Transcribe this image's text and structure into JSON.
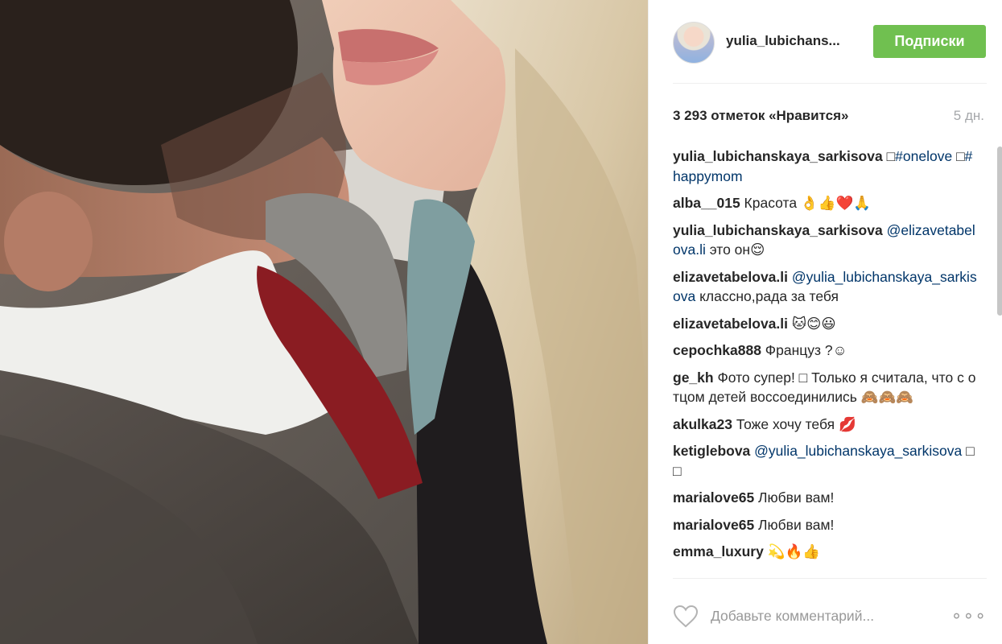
{
  "post": {
    "author": "yulia_lubichans...",
    "follow_label": "Подписки",
    "likes": "3 293 отметок «Нравится»",
    "time": "5 дн."
  },
  "comments": [
    {
      "author": "yulia_lubichanskaya_sarkisova",
      "parts": [
        {
          "t": "text",
          "v": " □"
        },
        {
          "t": "mention",
          "v": "#onelove"
        },
        {
          "t": "text",
          "v": " □"
        },
        {
          "t": "mention",
          "v": "#happymom"
        }
      ]
    },
    {
      "author": "alba__015",
      "parts": [
        {
          "t": "text",
          "v": " Красота 👌👍❤️🙏"
        }
      ]
    },
    {
      "author": "yulia_lubichanskaya_sarkisova",
      "parts": [
        {
          "t": "text",
          "v": " "
        },
        {
          "t": "mention",
          "v": "@elizavetabelova.li"
        },
        {
          "t": "text",
          "v": " это он😌"
        }
      ]
    },
    {
      "author": "elizavetabelova.li",
      "parts": [
        {
          "t": "text",
          "v": " "
        },
        {
          "t": "mention",
          "v": "@yulia_lubichanskaya_sarkisova"
        },
        {
          "t": "text",
          "v": " классно,рада за тебя"
        }
      ]
    },
    {
      "author": "elizavetabelova.li",
      "parts": [
        {
          "t": "text",
          "v": " 🐱😊😃"
        }
      ]
    },
    {
      "author": "cepochka888",
      "parts": [
        {
          "t": "text",
          "v": " Француз ?☺"
        }
      ]
    },
    {
      "author": "ge_kh",
      "parts": [
        {
          "t": "text",
          "v": " Фото супер! □ Только я считала, что с отцом детей воссоединились 🙈🙈🙈"
        }
      ]
    },
    {
      "author": "akulka23",
      "parts": [
        {
          "t": "text",
          "v": " Тоже хочу тебя 💋"
        }
      ]
    },
    {
      "author": "ketiglebova",
      "parts": [
        {
          "t": "text",
          "v": " "
        },
        {
          "t": "mention",
          "v": "@yulia_lubichanskaya_sarkisova"
        },
        {
          "t": "text",
          "v": " □□"
        }
      ]
    },
    {
      "author": "marialove65",
      "parts": [
        {
          "t": "text",
          "v": " Любви вам!"
        }
      ]
    },
    {
      "author": "marialove65",
      "parts": [
        {
          "t": "text",
          "v": " Любви вам!"
        }
      ]
    },
    {
      "author": "emma_luxury",
      "parts": [
        {
          "t": "text",
          "v": " 💫🔥👍"
        }
      ]
    }
  ],
  "footer": {
    "comment_placeholder": "Добавьте комментарий...",
    "more_label": "∘∘∘"
  },
  "icons": {
    "heart": "heart-icon",
    "more": "more-options-icon"
  },
  "colors": {
    "follow_button": "#70c050",
    "mention": "#003569",
    "timestamp": "#a5a7aa"
  }
}
